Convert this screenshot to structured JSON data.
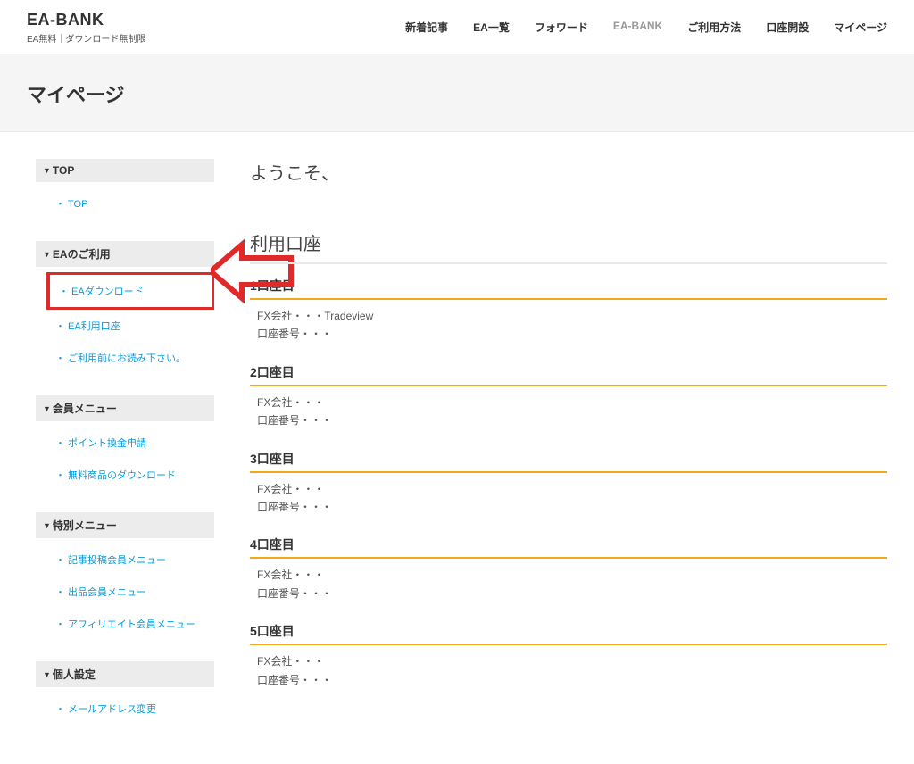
{
  "header": {
    "logo_title": "EA-BANK",
    "logo_sub": "EA無料｜ダウンロード無制限",
    "nav": [
      {
        "label": "新着記事",
        "active": false
      },
      {
        "label": "EA一覧",
        "active": false
      },
      {
        "label": "フォワード",
        "active": false
      },
      {
        "label": "EA-BANK",
        "active": true
      },
      {
        "label": "ご利用方法",
        "active": false
      },
      {
        "label": "口座開設",
        "active": false
      },
      {
        "label": "マイページ",
        "active": false
      }
    ]
  },
  "page_title": "マイページ",
  "sidebar": [
    {
      "title": "TOP",
      "items": [
        {
          "label": "TOP",
          "highlight": false
        }
      ]
    },
    {
      "title": "EAのご利用",
      "items": [
        {
          "label": "EAダウンロード",
          "highlight": true
        },
        {
          "label": "EA利用口座",
          "highlight": false
        },
        {
          "label": "ご利用前にお読み下さい。",
          "highlight": false
        }
      ]
    },
    {
      "title": "会員メニュー",
      "items": [
        {
          "label": "ポイント換金申請",
          "highlight": false
        },
        {
          "label": "無料商品のダウンロード",
          "highlight": false
        }
      ]
    },
    {
      "title": "特別メニュー",
      "items": [
        {
          "label": "記事投稿会員メニュー",
          "highlight": false
        },
        {
          "label": "出品会員メニュー",
          "highlight": false
        },
        {
          "label": "アフィリエイト会員メニュー",
          "highlight": false
        }
      ]
    },
    {
      "title": "個人設定",
      "items": [
        {
          "label": "メールアドレス変更",
          "highlight": false
        }
      ]
    }
  ],
  "main": {
    "welcome": "ようこそ、",
    "section_title": "利用口座",
    "accounts": [
      {
        "head": "1口座目",
        "company_label": "FX会社・・・",
        "company_value": "Tradeview",
        "number_label": "口座番号・・・"
      },
      {
        "head": "2口座目",
        "company_label": "FX会社・・・",
        "company_value": "",
        "number_label": "口座番号・・・"
      },
      {
        "head": "3口座目",
        "company_label": "FX会社・・・",
        "company_value": "",
        "number_label": "口座番号・・・"
      },
      {
        "head": "4口座目",
        "company_label": "FX会社・・・",
        "company_value": "",
        "number_label": "口座番号・・・"
      },
      {
        "head": "5口座目",
        "company_label": "FX会社・・・",
        "company_value": "",
        "number_label": "口座番号・・・"
      }
    ]
  }
}
